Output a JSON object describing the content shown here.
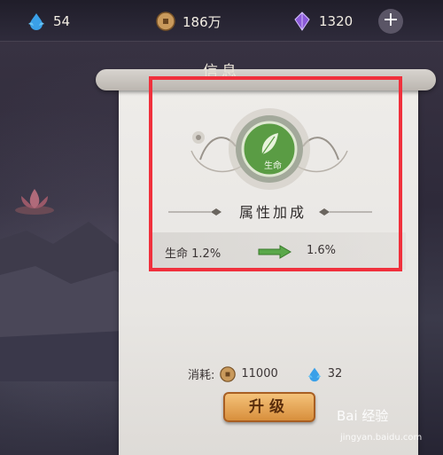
{
  "resources": [
    {
      "icon": "water-drop-icon",
      "value": "54"
    },
    {
      "icon": "copper-coin-icon",
      "value": "186万"
    },
    {
      "icon": "purple-crystal-icon",
      "value": "1320"
    }
  ],
  "add_button": {
    "icon": "plus-icon",
    "label": "+"
  },
  "panel": {
    "title": "信息",
    "emblem_label": "生命",
    "attr_title": "属性加成",
    "stat": {
      "name": "生命",
      "before": "1.2%",
      "after": "1.6%"
    }
  },
  "cost": {
    "label": "消耗:",
    "coin_amount": "11000",
    "drop_amount": "32"
  },
  "upgrade_button": {
    "label": "升级"
  },
  "watermark": {
    "brand": "Bai 经验",
    "url": "jingyan.baidu.com"
  },
  "colors": {
    "highlight_frame": "#f0303c",
    "emblem_green": "#4a9a3a",
    "button_orange": "#e3a050"
  }
}
